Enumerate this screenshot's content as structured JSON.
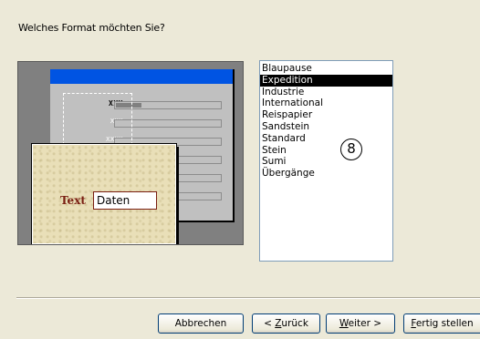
{
  "question": "Welches Format möchten Sie?",
  "preview": {
    "field_labels": [
      "XXX",
      "XXX",
      "XXXX"
    ],
    "zoom_label": "Text",
    "zoom_value": "Daten"
  },
  "styles": {
    "items": [
      "Blaupause",
      "Expedition",
      "Industrie",
      "International",
      "Reispapier",
      "Sandstein",
      "Standard",
      "Stein",
      "Sumi",
      "Übergänge"
    ],
    "selected": "Expedition"
  },
  "step_marker": "8",
  "buttons": {
    "cancel": "Abbrechen",
    "back_prefix": "< ",
    "back_mnemonic": "Z",
    "back_rest": "urück",
    "next_mnemonic": "W",
    "next_rest": "eiter >",
    "finish_mnemonic": "F",
    "finish_rest": "ertig stellen"
  },
  "colors": {
    "selection_bg": "#000000",
    "titlebar": "#0054e3",
    "zoom_text": "#7a1f12"
  }
}
